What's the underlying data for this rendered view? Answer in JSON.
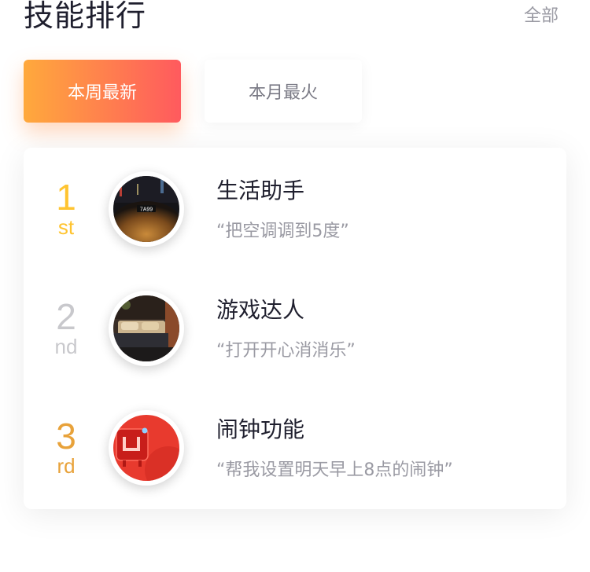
{
  "header": {
    "title": "技能排行",
    "all_label": "全部"
  },
  "tabs": [
    {
      "label": "本周最新",
      "active": true
    },
    {
      "label": "本月最火",
      "active": false
    }
  ],
  "ranking": [
    {
      "rank": "1",
      "suffix": "st",
      "rank_color": "#ffc430",
      "name": "生活助手",
      "quote": "“把空调调到5度”",
      "image": "night-car-scene"
    },
    {
      "rank": "2",
      "suffix": "nd",
      "rank_color": "#c8c8cc",
      "name": "游戏达人",
      "quote": "“打开开心消消乐”",
      "image": "bedroom-scene"
    },
    {
      "rank": "3",
      "suffix": "rd",
      "rank_color": "#e8a23a",
      "name": "闹钟功能",
      "quote": "“帮我设置明天早上8点的闹钟”",
      "image": "red-clock-device"
    }
  ],
  "colors": {
    "tab_gradient_start": "#ffa93c",
    "tab_gradient_end": "#ff5a5e"
  }
}
